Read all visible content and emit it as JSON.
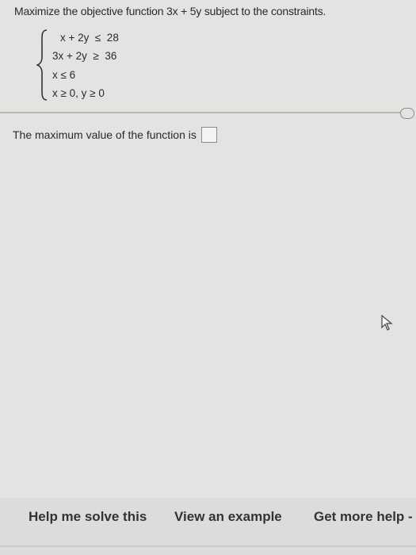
{
  "question": {
    "text": "Maximize the objective function 3x + 5y subject to the constraints."
  },
  "constraints": [
    "x + 2y  ≤  28",
    "3x + 2y  ≥  36",
    "x ≤ 6",
    "x ≥ 0, y ≥ 0"
  ],
  "answer": {
    "prompt": "The maximum value of the function is",
    "value": ""
  },
  "footer": {
    "help_label": "Help me solve this",
    "example_label": "View an example",
    "more_label": "Get more help -"
  },
  "icons": [
    "left-brace-icon",
    "mouse-cursor-icon"
  ]
}
